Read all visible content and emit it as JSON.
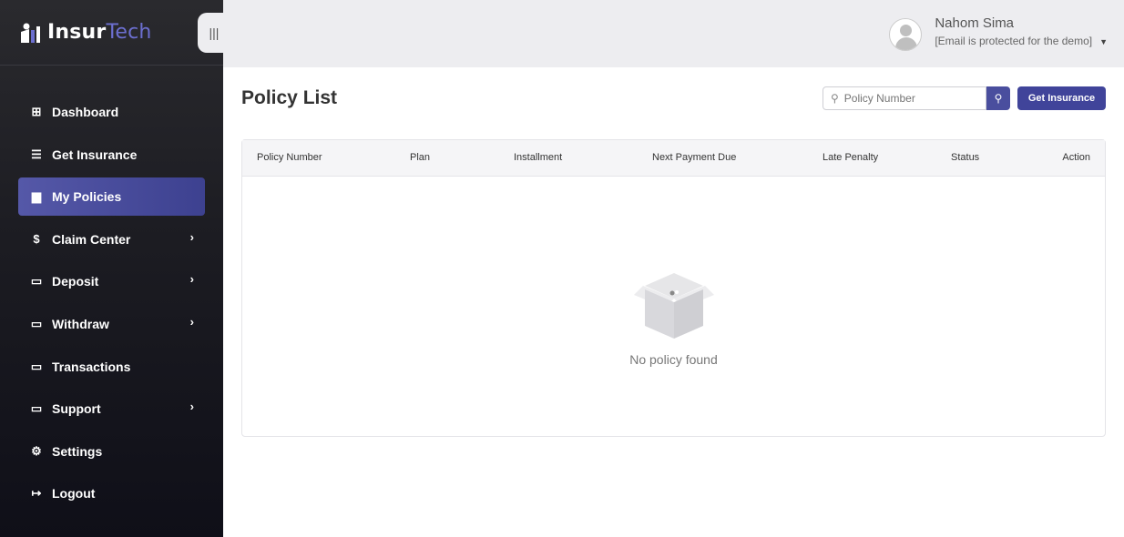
{
  "brand": {
    "name_main": "Insur",
    "name_accent": "Tech"
  },
  "header": {
    "user_name": "Nahom Sima",
    "user_email": "[Email is protected for the demo]"
  },
  "sidebar": {
    "items": [
      {
        "label": "Dashboard",
        "icon": "grid-icon",
        "has_arrow": false
      },
      {
        "label": "Get Insurance",
        "icon": "checklist-icon",
        "has_arrow": false
      },
      {
        "label": "My Policies",
        "icon": "document-icon",
        "has_arrow": false,
        "active": true
      },
      {
        "label": "Claim Center",
        "icon": "file-dollar-icon",
        "has_arrow": true
      },
      {
        "label": "Deposit",
        "icon": "cash-icon",
        "has_arrow": true
      },
      {
        "label": "Withdraw",
        "icon": "money-icon",
        "has_arrow": true
      },
      {
        "label": "Transactions",
        "icon": "card-icon",
        "has_arrow": false
      },
      {
        "label": "Support",
        "icon": "ticket-icon",
        "has_arrow": true
      },
      {
        "label": "Settings",
        "icon": "gear-icon",
        "has_arrow": false
      },
      {
        "label": "Logout",
        "icon": "logout-icon",
        "has_arrow": false
      }
    ]
  },
  "main": {
    "title": "Policy List",
    "search_placeholder": "Policy Number",
    "get_insurance_label": "Get Insurance",
    "columns": [
      "Policy Number",
      "Plan",
      "Installment",
      "Next Payment Due",
      "Late Penalty",
      "Status",
      "Action"
    ],
    "empty_message": "No policy found"
  },
  "colors": {
    "accent": "#40449a",
    "active_nav": "#4a4e9e",
    "sidebar_bg": "#1c1c22",
    "topbar_bg": "#ededf0"
  }
}
